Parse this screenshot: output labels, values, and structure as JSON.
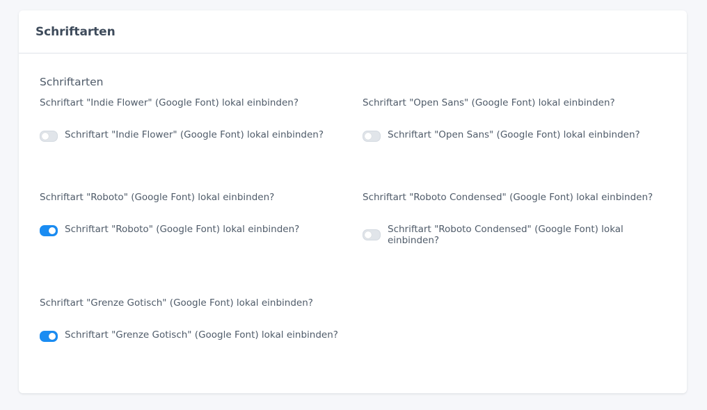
{
  "card": {
    "title": "Schriftarten"
  },
  "section": {
    "heading": "Schriftarten"
  },
  "fields": [
    {
      "label": "Schriftart \"Indie Flower\" (Google Font) lokal einbinden?",
      "toggle_text": "Schriftart \"Indie Flower\" (Google Font) lokal einbinden?",
      "enabled": false
    },
    {
      "label": "Schriftart \"Open Sans\" (Google Font) lokal einbinden?",
      "toggle_text": "Schriftart \"Open Sans\" (Google Font) lokal einbinden?",
      "enabled": false
    },
    {
      "label": "Schriftart \"Roboto\" (Google Font) lokal einbinden?",
      "toggle_text": "Schriftart \"Roboto\" (Google Font) lokal einbinden?",
      "enabled": true
    },
    {
      "label": "Schriftart \"Roboto Condensed\" (Google Font) lokal einbinden?",
      "toggle_text": "Schriftart \"Roboto Condensed\" (Google Font) lokal einbinden?",
      "enabled": false
    },
    {
      "label": "Schriftart \"Grenze Gotisch\" (Google Font) lokal einbinden?",
      "toggle_text": "Schriftart \"Grenze Gotisch\" (Google Font) lokal einbinden?",
      "enabled": true
    }
  ],
  "colors": {
    "toggle_on": "#1a8cf2",
    "toggle_off": "#e1e5ea"
  }
}
